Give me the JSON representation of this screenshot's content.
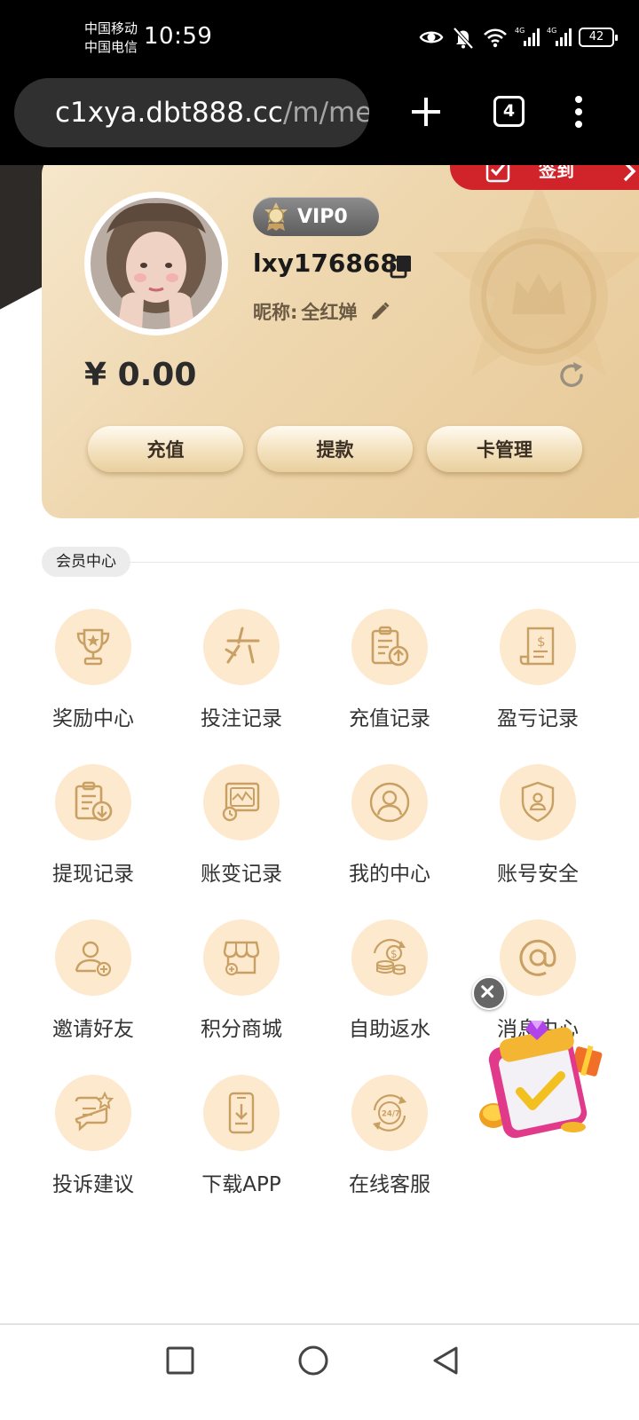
{
  "status_bar": {
    "carrier_1": "中国移动",
    "carrier_2": "中国电信",
    "time": "10:59",
    "battery": "42",
    "icons": [
      "eye-icon",
      "mute-icon",
      "wifi-icon",
      "signal-4g-icon",
      "signal-4g-icon"
    ]
  },
  "browser": {
    "url_host": "c1xya.dbt888.cc",
    "url_path": "/m/me",
    "tab_count": "4"
  },
  "profile": {
    "sign_in_label": "签到",
    "vip_level": "VIP0",
    "username": "lxy176868",
    "nickname_label": "昵称:",
    "nickname": "全红婵",
    "balance": "¥ 0.00",
    "actions": [
      "充值",
      "提款",
      "卡管理"
    ]
  },
  "section": {
    "title": "会员中心"
  },
  "menu": [
    {
      "label": "奖励中心",
      "icon": "trophy-icon"
    },
    {
      "label": "投注记录",
      "icon": "bet-record-icon"
    },
    {
      "label": "充值记录",
      "icon": "deposit-record-icon"
    },
    {
      "label": "盈亏记录",
      "icon": "profit-loss-icon"
    },
    {
      "label": "提现记录",
      "icon": "withdraw-record-icon"
    },
    {
      "label": "账变记录",
      "icon": "account-change-icon"
    },
    {
      "label": "我的中心",
      "icon": "user-icon"
    },
    {
      "label": "账号安全",
      "icon": "shield-user-icon"
    },
    {
      "label": "邀请好友",
      "icon": "add-user-icon"
    },
    {
      "label": "积分商城",
      "icon": "shop-icon"
    },
    {
      "label": "自助返水",
      "icon": "coins-icon"
    },
    {
      "label": "消息中心",
      "icon": "at-icon"
    },
    {
      "label": "投诉建议",
      "icon": "feedback-icon"
    },
    {
      "label": "下载APP",
      "icon": "download-app-icon"
    },
    {
      "label": "在线客服",
      "icon": "support-247-icon"
    }
  ],
  "colors": {
    "accent_gold": "#c9a063",
    "icon_circle": "#fde9cd",
    "sign_in_red": "#d0242a"
  }
}
